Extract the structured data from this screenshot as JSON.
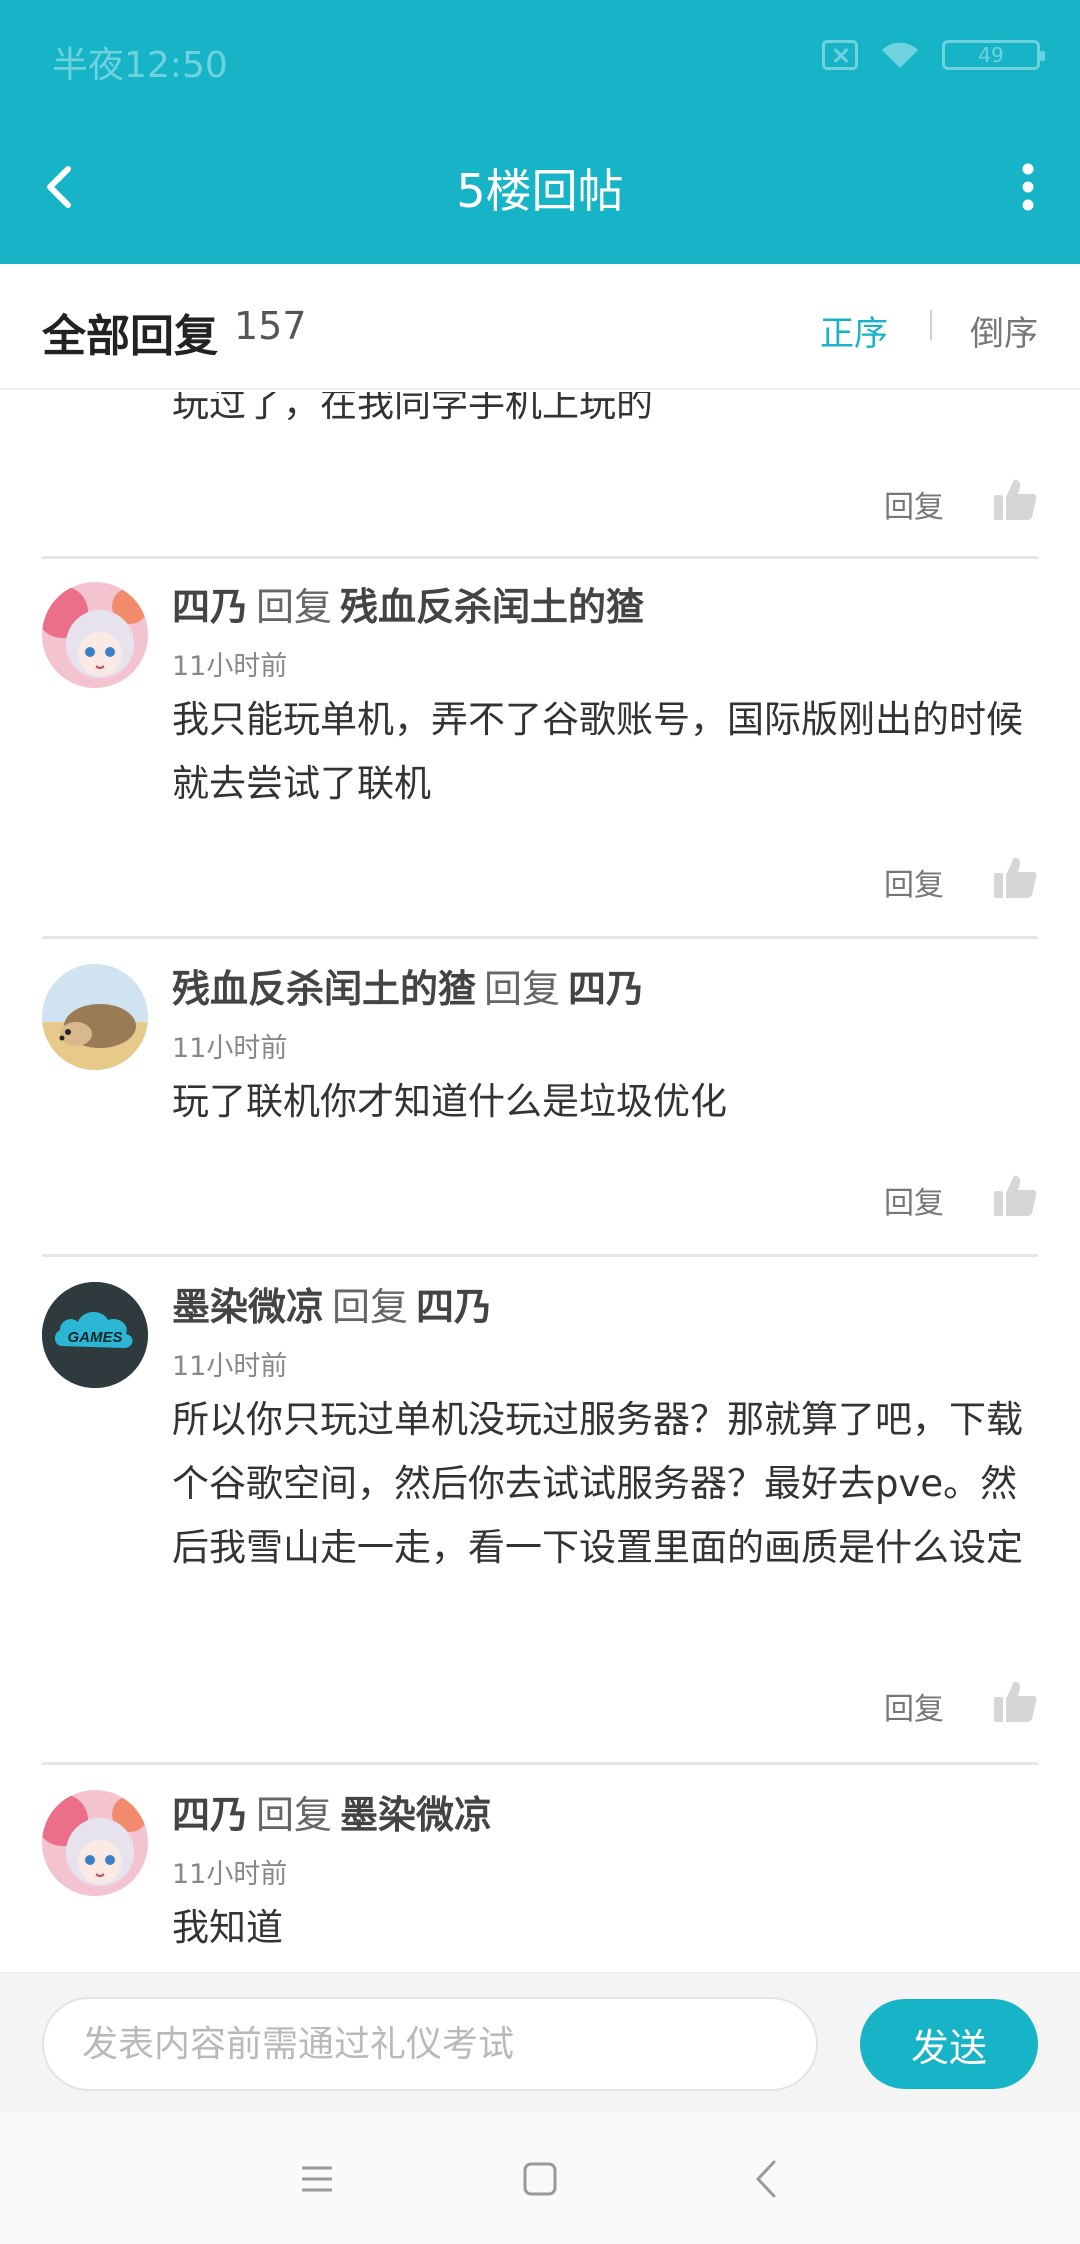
{
  "status_bar": {
    "time": "半夜12:50",
    "battery": "49"
  },
  "header": {
    "title": "5楼回帖"
  },
  "reply_header": {
    "title": "全部回复",
    "count": "157",
    "sort_asc": "正序",
    "sort_desc": "倒序"
  },
  "comments": [
    {
      "text": "玩过了，在我同学手机上玩的",
      "reply_label": "回复"
    },
    {
      "user": "四乃",
      "reply_word": "回复",
      "target": "残血反杀闰土的猹",
      "time": "11小时前",
      "text": "我只能玩单机，弄不了谷歌账号，国际版刚出的时候就去尝试了联机",
      "reply_label": "回复"
    },
    {
      "user": "残血反杀闰土的猹",
      "reply_word": "回复",
      "target": "四乃",
      "time": "11小时前",
      "text": "玩了联机你才知道什么是垃圾优化",
      "reply_label": "回复"
    },
    {
      "user": "墨染微凉",
      "reply_word": "回复",
      "target": "四乃",
      "time": "11小时前",
      "text": "所以你只玩过单机没玩过服务器？那就算了吧，下载个谷歌空间，然后你去试试服务器？最好去pve。然后我雪山走一走，看一下设置里面的画质是什么设定",
      "reply_label": "回复",
      "avatar_text": "GAMES"
    },
    {
      "user": "四乃",
      "reply_word": "回复",
      "target": "墨染微凉",
      "time": "11小时前",
      "text": "我知道"
    }
  ],
  "composer": {
    "placeholder": "发表内容前需通过礼仪考试",
    "send_label": "发送"
  },
  "colors": {
    "accent": "#16b4c6"
  }
}
